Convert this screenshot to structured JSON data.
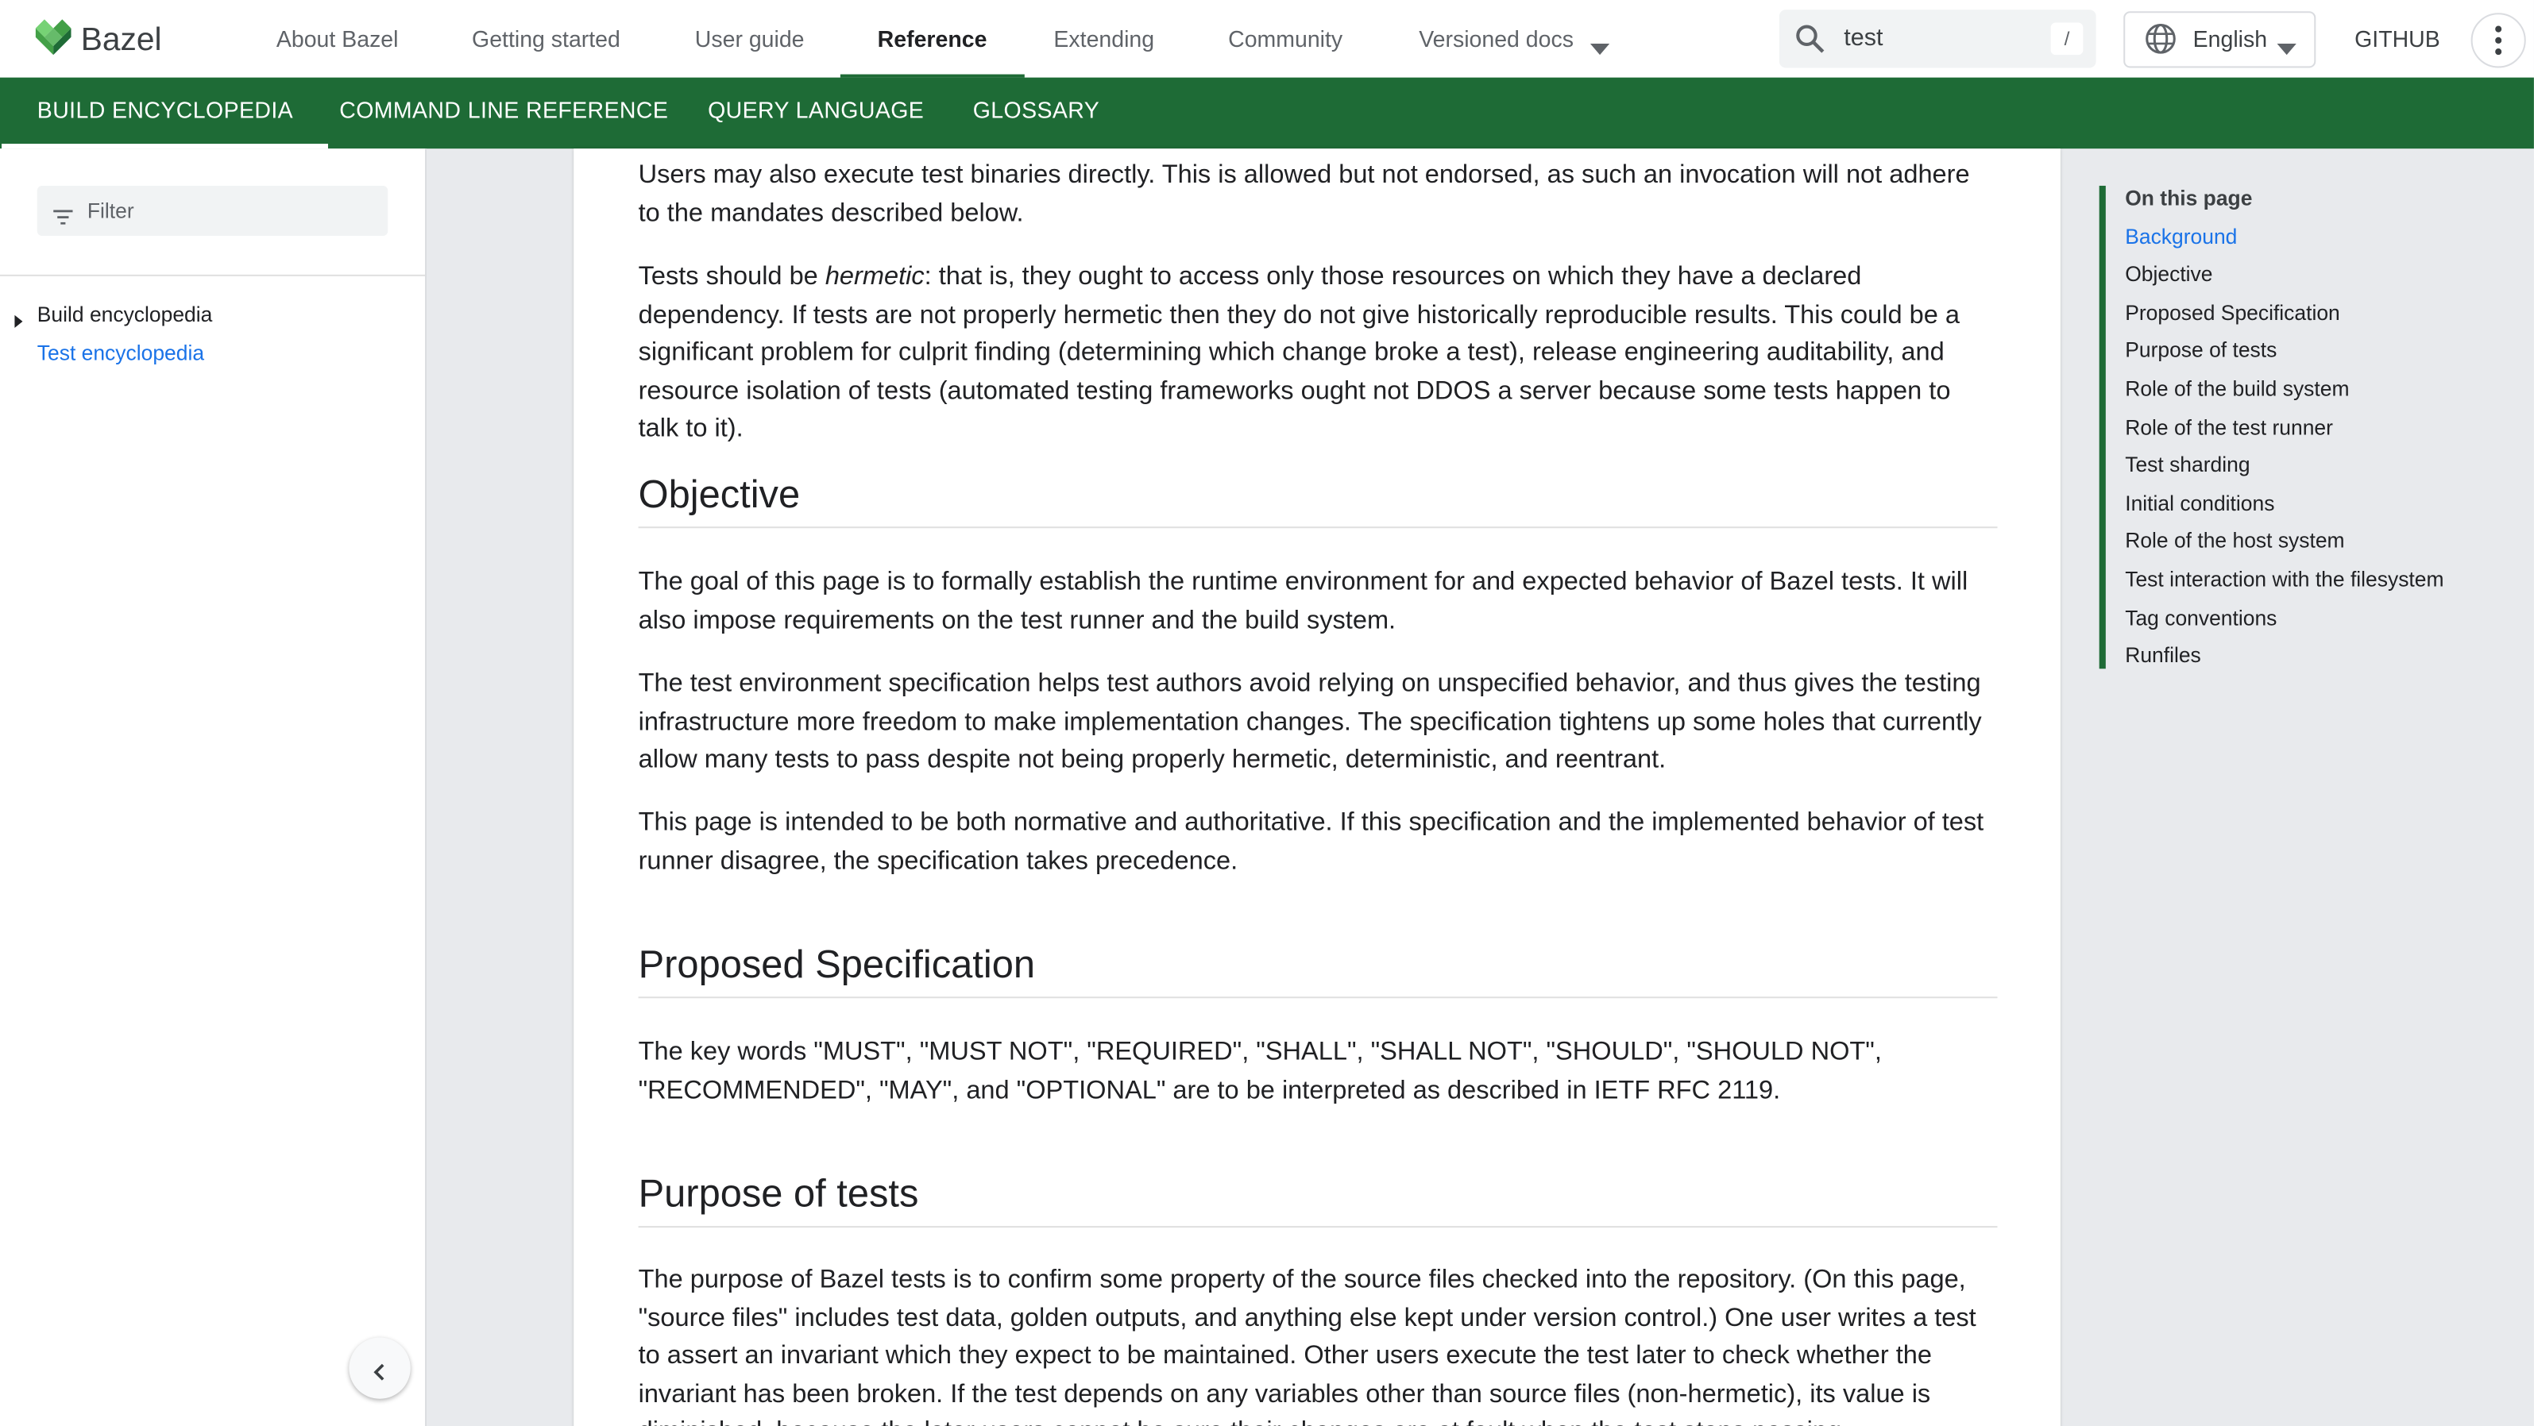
{
  "brand": {
    "name": "Bazel",
    "logo_icon": "bazel-logo-icon",
    "accent": "#1e6b36"
  },
  "topnav": [
    "About Bazel",
    "Getting started",
    "User guide",
    "Reference",
    "Extending",
    "Community",
    "Versioned docs"
  ],
  "search": {
    "value": "test",
    "shortcut": "/"
  },
  "language": "English",
  "github": "GITHUB",
  "tabs": [
    "BUILD ENCYCLOPEDIA",
    "COMMAND LINE REFERENCE",
    "QUERY LANGUAGE",
    "GLOSSARY"
  ],
  "sidebar": {
    "filter_placeholder": "Filter",
    "items": [
      "Build encyclopedia",
      "Test encyclopedia"
    ]
  },
  "article": {
    "p1": "Users may also execute test binaries directly. This is allowed but not endorsed, as such an invocation will not adhere to the mandates described below.",
    "p2_pre": "Tests should be ",
    "p2_em": "hermetic",
    "p2_post": ": that is, they ought to access only those resources on which they have a declared dependency. If tests are not properly hermetic then they do not give historically reproducible results. This could be a significant problem for culprit finding (determining which change broke a test), release engineering auditability, and resource isolation of tests (automated testing frameworks ought not DDOS a server because some tests happen to talk to it).",
    "h_objective": "Objective",
    "p3": "The goal of this page is to formally establish the runtime environment for and expected behavior of Bazel tests. It will also impose requirements on the test runner and the build system.",
    "p4": "The test environment specification helps test authors avoid relying on unspecified behavior, and thus gives the testing infrastructure more freedom to make implementation changes. The specification tightens up some holes that currently allow many tests to pass despite not being properly hermetic, deterministic, and reentrant.",
    "p5": "This page is intended to be both normative and authoritative. If this specification and the implemented behavior of test runner disagree, the specification takes precedence.",
    "h_proposed": "Proposed Specification",
    "p6": "The key words \"MUST\", \"MUST NOT\", \"REQUIRED\", \"SHALL\", \"SHALL NOT\", \"SHOULD\", \"SHOULD NOT\", \"RECOMMENDED\", \"MAY\", and \"OPTIONAL\" are to be interpreted as described in IETF RFC 2119.",
    "h_purpose": "Purpose of tests",
    "p7": "The purpose of Bazel tests is to confirm some property of the source files checked into the repository. (On this page, \"source files\" includes test data, golden outputs, and anything else kept under version control.) One user writes a test to assert an invariant which they expect to be maintained. Other users execute the test later to check whether the invariant has been broken. If the test depends on any variables other than source files (non-hermetic), its value is diminished, because the later users cannot be sure their changes are at fault when the test stops passing."
  },
  "toc": {
    "title": "On this page",
    "items": [
      "Background",
      "Objective",
      "Proposed Specification",
      "Purpose of tests",
      "Role of the build system",
      "Role of the test runner",
      "Test sharding",
      "Initial conditions",
      "Role of the host system",
      "Test interaction with the filesystem",
      "Tag conventions",
      "Runfiles"
    ]
  }
}
